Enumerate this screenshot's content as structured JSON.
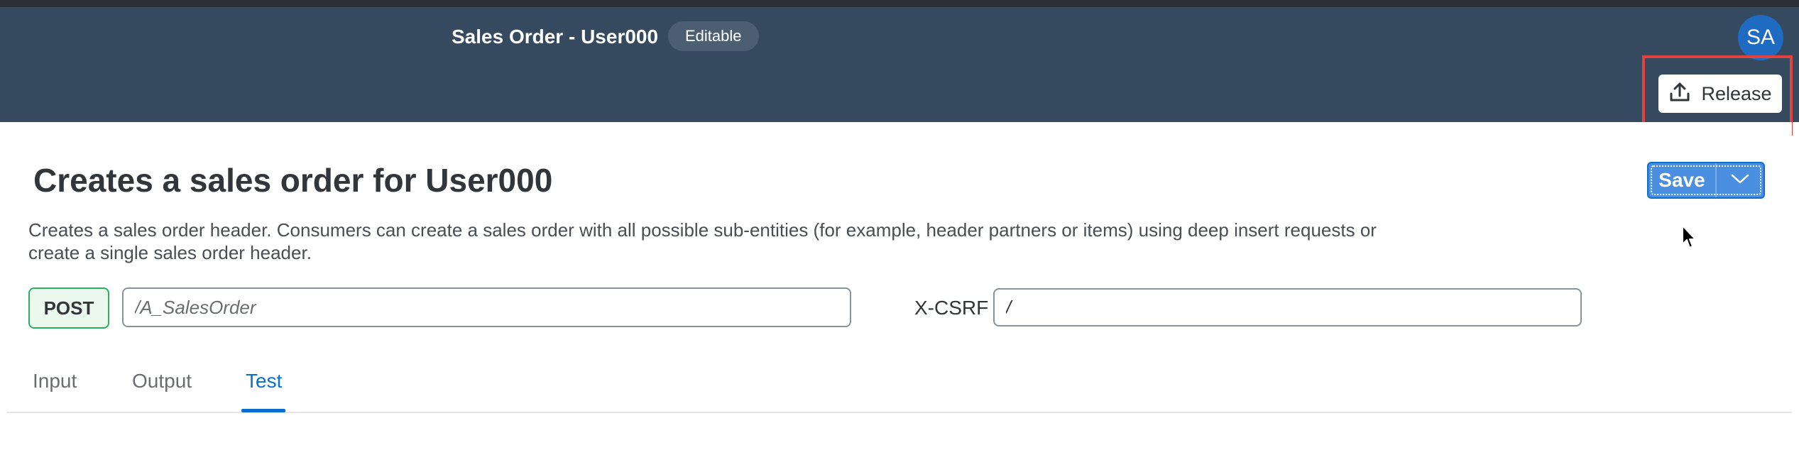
{
  "header": {
    "app_title": "Sales Order - User000",
    "status_badge": "Editable",
    "avatar_initials": "SA",
    "release_label": "Release"
  },
  "main": {
    "title": "Creates a sales order for User000",
    "description": "Creates a sales order header. Consumers can create a sales order with all possible sub-entities (for example, header partners or items) using deep insert requests or create a single sales order header.",
    "save_label": "Save",
    "method": "POST",
    "path_placeholder": "/A_SalesOrder",
    "csrf_label": "X-CSRF",
    "csrf_value": "/"
  },
  "tabs": [
    {
      "label": "Input",
      "active": false
    },
    {
      "label": "Output",
      "active": false
    },
    {
      "label": "Test",
      "active": true
    }
  ],
  "colors": {
    "shell_background": "#354a5f",
    "accent": "#0a6ed1",
    "highlight": "#e2433f",
    "method_border": "#2eae5f"
  },
  "icons": {
    "release": "upload-icon",
    "save_dropdown": "chevron-down-icon",
    "cursor": "mouse-pointer-icon"
  }
}
